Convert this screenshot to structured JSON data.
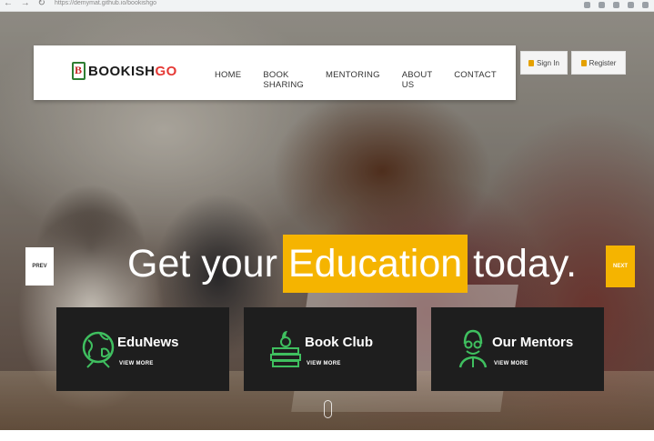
{
  "browser": {
    "url": "https://demymat.github.io/bookishgo"
  },
  "header": {
    "logo_word": "BOOKISH",
    "logo_accent": "GO",
    "nav": [
      {
        "label": "HOME"
      },
      {
        "label": "BOOK SHARING"
      },
      {
        "label": "MENTORING"
      },
      {
        "label": "ABOUT US"
      },
      {
        "label": "CONTACT"
      }
    ],
    "sign_in_label": "Sign In",
    "register_label": "Register"
  },
  "slider": {
    "headline_before": "Get your",
    "headline_highlight": "Education",
    "headline_after": "today.",
    "prev_label": "PREV",
    "next_label": "NEXT"
  },
  "features": [
    {
      "title": "EduNews",
      "link": "VIEW MORE",
      "icon": "globe-icon"
    },
    {
      "title": "Book Club",
      "link": "VIEW MORE",
      "icon": "books-icon"
    },
    {
      "title": "Our Mentors",
      "link": "VIEW MORE",
      "icon": "mentor-icon"
    }
  ],
  "colors": {
    "accent": "#f5b400",
    "logo_go": "#e53935",
    "card_bg": "#1e1e1e",
    "icon_green": "#3fbf5f"
  }
}
